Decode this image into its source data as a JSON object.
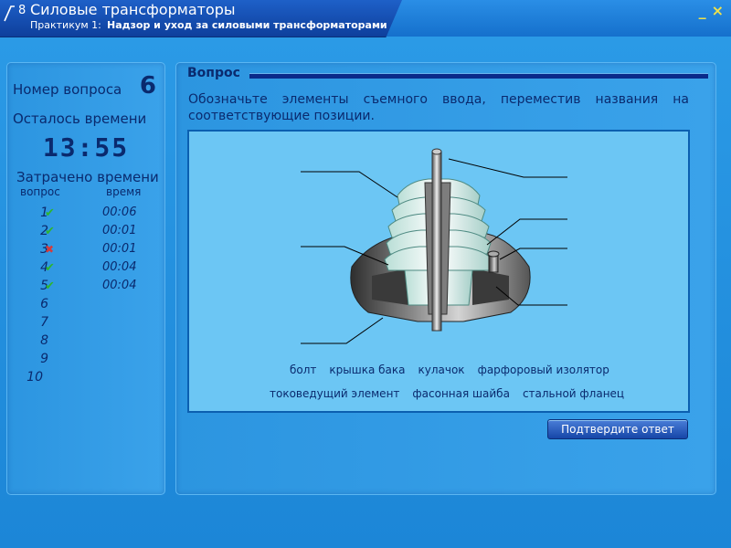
{
  "header": {
    "number": "8",
    "title": "Силовые трансформаторы",
    "subtitle_prefix": "Практикум 1:",
    "subtitle_bold": "Надзор и уход за силовыми трансформаторами",
    "minimize_label": "_",
    "close_label": "×"
  },
  "sidebar": {
    "question_label": "Номер вопроса",
    "question_number": "6",
    "remaining_label": "Осталось времени",
    "timer": "13:55",
    "spent_label": "Затрачено времени",
    "col_question": "вопрос",
    "col_time": "время",
    "rows": [
      {
        "num": "1",
        "status": "correct",
        "time": "00:06"
      },
      {
        "num": "2",
        "status": "correct",
        "time": "00:01"
      },
      {
        "num": "3",
        "status": "wrong",
        "time": "00:01"
      },
      {
        "num": "4",
        "status": "correct",
        "time": "00:04"
      },
      {
        "num": "5",
        "status": "correct",
        "time": "00:04"
      },
      {
        "num": "6",
        "status": "",
        "time": ""
      },
      {
        "num": "7",
        "status": "",
        "time": ""
      },
      {
        "num": "8",
        "status": "",
        "time": ""
      },
      {
        "num": "9",
        "status": "",
        "time": ""
      },
      {
        "num": "10",
        "status": "",
        "time": ""
      }
    ]
  },
  "main": {
    "section_title": "Вопрос",
    "question_text": "Обозначьте элементы съемного ввода, переместив названия на соответствующие позиции.",
    "labels_row1": [
      "болт",
      "крышка бака",
      "кулачок",
      "фарфоровый изолятор"
    ],
    "labels_row2": [
      "токоведущий элемент",
      "фасонная шайба",
      "стальной фланец"
    ],
    "confirm_label": "Подтвердите ответ"
  },
  "colors": {
    "accent_dark": "#0a2a6e",
    "correct": "#2eb52e",
    "wrong": "#d63a3a",
    "header_title": "#ffffff",
    "window_buttons": "#f0e24a"
  }
}
